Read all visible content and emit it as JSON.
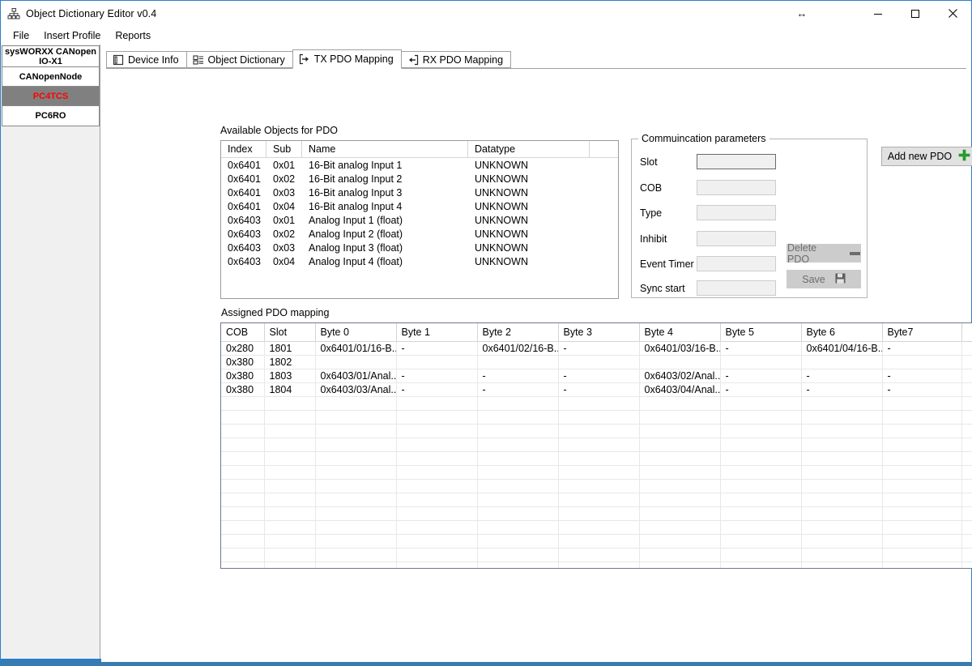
{
  "window": {
    "title": "Object Dictionary Editor v0.4",
    "app_icon": "hierarchy-icon",
    "resize_cursor_glyph": "↔",
    "caption_buttons": [
      {
        "name": "minimize",
        "label": "—"
      },
      {
        "name": "maximize",
        "label": "□"
      },
      {
        "name": "close",
        "label": "✕"
      }
    ]
  },
  "menubar": {
    "items": [
      {
        "label": "File"
      },
      {
        "label": "Insert Profile"
      },
      {
        "label": "Reports"
      }
    ]
  },
  "sidebar": {
    "devices": [
      {
        "label": "sysWORXX CANopen IO-X1",
        "selected": false
      },
      {
        "label": "CANopenNode",
        "selected": false
      },
      {
        "label": "PC4TCS",
        "selected": true
      },
      {
        "label": "PC6RO",
        "selected": false
      }
    ]
  },
  "tabs": [
    {
      "label": "Device Info",
      "icon": "document-icon",
      "selected": false
    },
    {
      "label": "Object Dictionary",
      "icon": "list-details-icon",
      "selected": false
    },
    {
      "label": "TX PDO Mapping",
      "icon": "arrow-right-out-icon",
      "selected": true
    },
    {
      "label": "RX PDO Mapping",
      "icon": "arrow-left-in-icon",
      "selected": false
    }
  ],
  "available_objects": {
    "caption": "Available Objects for PDO",
    "columns": [
      "Index",
      "Sub",
      "Name",
      "Datatype"
    ],
    "rows": [
      {
        "index": "0x6401",
        "sub": "0x01",
        "name": "16-Bit analog Input 1",
        "datatype": "UNKNOWN"
      },
      {
        "index": "0x6401",
        "sub": "0x02",
        "name": "16-Bit analog Input 2",
        "datatype": "UNKNOWN"
      },
      {
        "index": "0x6401",
        "sub": "0x03",
        "name": "16-Bit analog Input 3",
        "datatype": "UNKNOWN"
      },
      {
        "index": "0x6401",
        "sub": "0x04",
        "name": "16-Bit analog Input 4",
        "datatype": "UNKNOWN"
      },
      {
        "index": "0x6403",
        "sub": "0x01",
        "name": "Analog Input 1 (float)",
        "datatype": "UNKNOWN"
      },
      {
        "index": "0x6403",
        "sub": "0x02",
        "name": "Analog Input 2 (float)",
        "datatype": "UNKNOWN"
      },
      {
        "index": "0x6403",
        "sub": "0x03",
        "name": "Analog Input 3 (float)",
        "datatype": "UNKNOWN"
      },
      {
        "index": "0x6403",
        "sub": "0x04",
        "name": "Analog Input 4 (float)",
        "datatype": "UNKNOWN"
      }
    ]
  },
  "communication_parameters": {
    "caption": "Commuincation parameters",
    "fields": [
      {
        "label": "Slot",
        "value": "",
        "focused": true
      },
      {
        "label": "COB",
        "value": "",
        "focused": false
      },
      {
        "label": "Type",
        "value": "",
        "focused": false
      },
      {
        "label": "Inhibit",
        "value": "",
        "focused": false
      },
      {
        "label": "Event Timer",
        "value": "",
        "focused": false
      },
      {
        "label": "Sync start",
        "value": "",
        "focused": false
      }
    ],
    "delete_pdo_label": "Delete PDO",
    "save_label": "Save",
    "delete_pdo_enabled": false,
    "save_enabled": false
  },
  "add_new_pdo": {
    "label": "Add new PDO",
    "icon": "plus-icon",
    "icon_color": "#22a12a",
    "enabled": true
  },
  "assigned_mapping": {
    "caption": "Assigned PDO mapping",
    "columns": [
      "COB",
      "Slot",
      "Byte 0",
      "Byte 1",
      "Byte 2",
      "Byte 3",
      "Byte 4",
      "Byte 5",
      "Byte 6",
      "Byte7",
      ""
    ],
    "rows": [
      {
        "cells": [
          "0x280",
          "1801",
          "0x6401/01/16-B...",
          "-",
          "0x6401/02/16-B...",
          "-",
          "0x6401/03/16-B...",
          "-",
          "0x6401/04/16-B...",
          "-",
          ""
        ]
      },
      {
        "cells": [
          "0x380",
          "1802",
          "",
          "",
          "",
          "",
          "",
          "",
          "",
          "",
          ""
        ]
      },
      {
        "cells": [
          "0x380",
          "1803",
          "0x6403/01/Anal...",
          "-",
          "-",
          "-",
          "0x6403/02/Anal...",
          "-",
          "-",
          "-",
          ""
        ]
      },
      {
        "cells": [
          "0x380",
          "1804",
          "0x6403/03/Anal...",
          "-",
          "-",
          "-",
          "0x6403/04/Anal...",
          "-",
          "-",
          "-",
          ""
        ]
      }
    ],
    "empty_row_count": 13
  },
  "theme": {
    "accent_border": "#2e7cc4",
    "selection_bg": "#808080",
    "selection_text": "#ff0000",
    "grid_border": "#707989"
  }
}
